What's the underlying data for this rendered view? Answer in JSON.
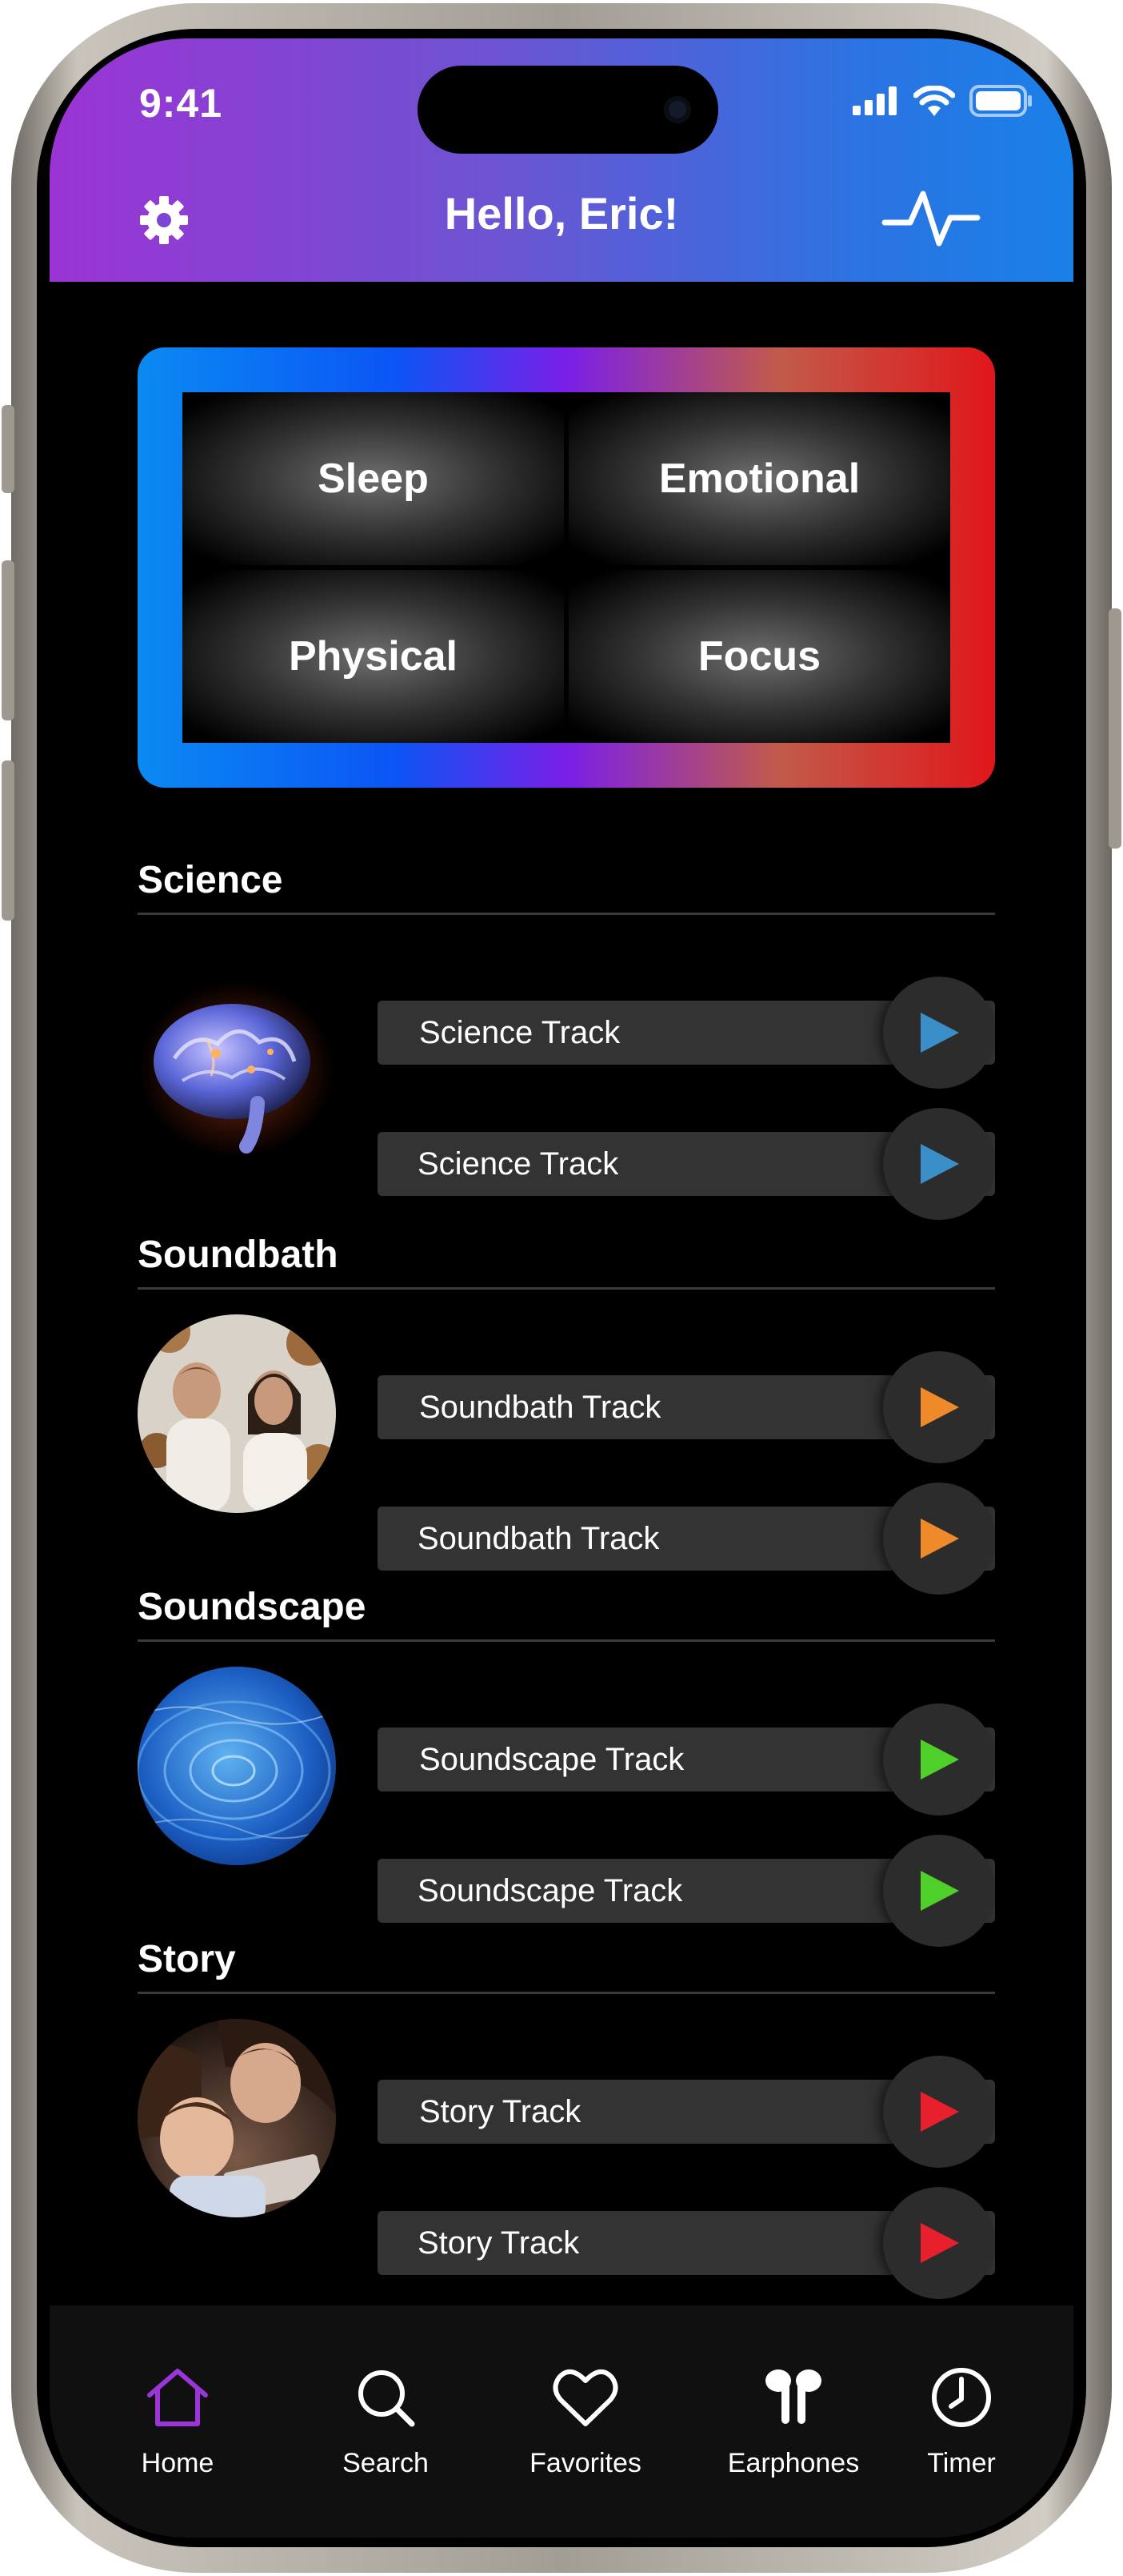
{
  "status_bar": {
    "time": "9:41"
  },
  "header": {
    "title": "Hello, Eric!",
    "settings_icon": "gear-icon",
    "activity_icon": "pulse-icon"
  },
  "categories": [
    {
      "label": "Sleep"
    },
    {
      "label": "Emotional"
    },
    {
      "label": "Physical"
    },
    {
      "label": "Focus"
    }
  ],
  "sections": [
    {
      "title": "Science",
      "accent": "#3a8fc8",
      "tracks": [
        "Science Track",
        "Science Track"
      ]
    },
    {
      "title": "Soundbath",
      "accent": "#ef8a2a",
      "tracks": [
        "Soundbath Track",
        "Soundbath Track"
      ]
    },
    {
      "title": "Soundscape",
      "accent": "#4ecf2a",
      "tracks": [
        "Soundscape Track",
        "Soundscape Track"
      ]
    },
    {
      "title": "Story",
      "accent": "#e8202e",
      "tracks": [
        "Story Track",
        "Story Track"
      ]
    }
  ],
  "tabbar": {
    "active_color": "#9b35d8",
    "items": [
      {
        "label": "Home",
        "icon": "home-icon",
        "active": true
      },
      {
        "label": "Search",
        "icon": "search-icon",
        "active": false
      },
      {
        "label": "Favorites",
        "icon": "heart-icon",
        "active": false
      },
      {
        "label": "Earphones",
        "icon": "earphones-icon",
        "active": false
      },
      {
        "label": "Timer",
        "icon": "clock-icon",
        "active": false
      }
    ]
  }
}
